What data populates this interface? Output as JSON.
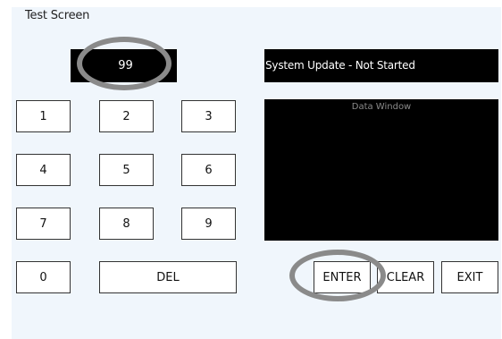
{
  "window": {
    "title": "Test Screen"
  },
  "display": {
    "value": "99"
  },
  "status": {
    "text": "System Update - Not Started"
  },
  "data_window": {
    "caption": "Data Window"
  },
  "keypad": {
    "k1": "1",
    "k2": "2",
    "k3": "3",
    "k4": "4",
    "k5": "5",
    "k6": "6",
    "k7": "7",
    "k8": "8",
    "k9": "9",
    "k0": "0",
    "del": "DEL"
  },
  "actions": {
    "enter": "ENTER",
    "clear": "CLEAR",
    "exit": "EXIT"
  },
  "colors": {
    "panel_bg": "#f0f6fc",
    "screen_bg": "#000000",
    "highlight_ring": "#8a8a8a"
  }
}
